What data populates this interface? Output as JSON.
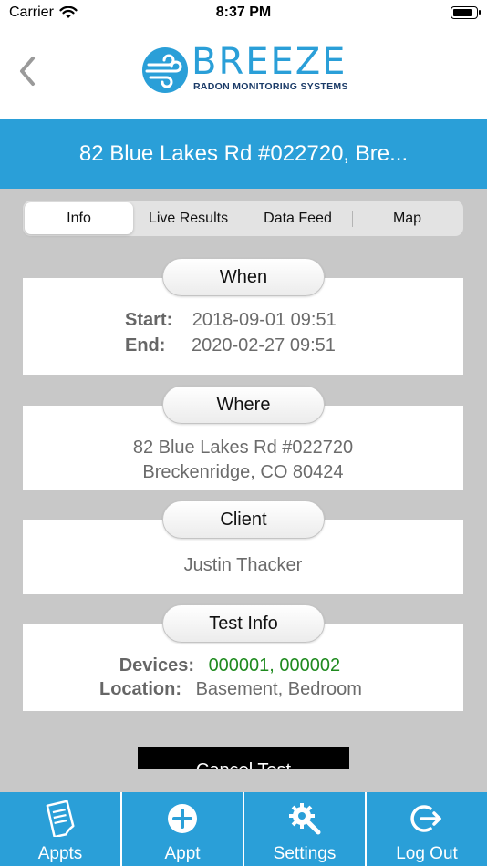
{
  "status_bar": {
    "carrier": "Carrier",
    "time": "8:37 PM",
    "battery_level": 0.9
  },
  "logo": {
    "word": "BREEZE",
    "subtitle": "RADON MONITORING SYSTEMS"
  },
  "title": "82 Blue Lakes Rd #022720, Bre...",
  "tabs": [
    {
      "label": "Info",
      "active": true
    },
    {
      "label": "Live Results",
      "active": false
    },
    {
      "label": "Data Feed",
      "active": false
    },
    {
      "label": "Map",
      "active": false
    }
  ],
  "when": {
    "header": "When",
    "start_label": "Start:",
    "start_value": "2018-09-01 09:51",
    "end_label": "End:",
    "end_value": "2020-02-27 09:51"
  },
  "where": {
    "header": "Where",
    "line1": "82 Blue Lakes Rd #022720",
    "line2": "Breckenridge, CO 80424"
  },
  "client": {
    "header": "Client",
    "name": "Justin Thacker"
  },
  "test_info": {
    "header": "Test Info",
    "devices_label": "Devices:",
    "devices_value": "000001, 000002",
    "location_label": "Location:",
    "location_value": "Basement, Bedroom"
  },
  "cancel_button": "Cancel Test",
  "bottom_tabs": [
    {
      "label": "Appts",
      "icon": "document-icon"
    },
    {
      "label": "Appt",
      "icon": "plus-circle-icon"
    },
    {
      "label": "Settings",
      "icon": "gear-wrench-icon"
    },
    {
      "label": "Log Out",
      "icon": "logout-icon"
    }
  ],
  "colors": {
    "brand": "#2a9fd8",
    "content_bg": "#c8c8c8",
    "devices_green": "#1f8a1f"
  }
}
